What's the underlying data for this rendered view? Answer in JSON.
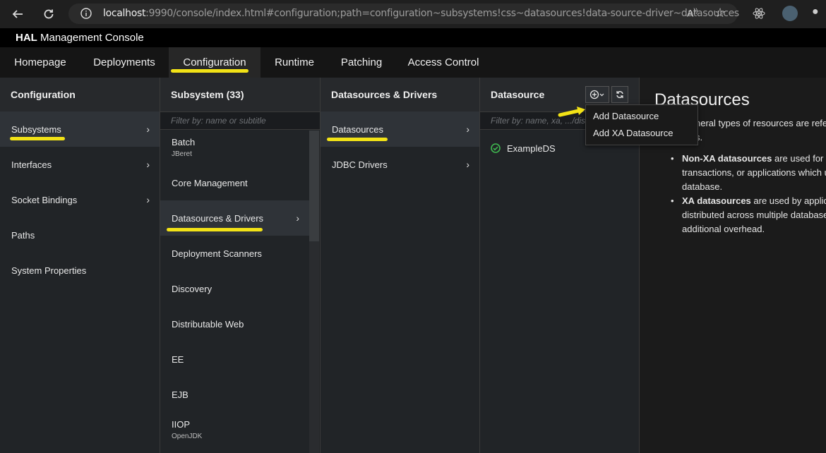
{
  "browser": {
    "url_host": "localhost",
    "url_rest": ":9990/console/index.html#configuration;path=configuration~subsystems!css~datasources!data-source-driver~datasources",
    "back_icon": "arrow-left-icon",
    "reload_icon": "reload-icon"
  },
  "app": {
    "title_bold": "HAL",
    "title_rest": "Management Console"
  },
  "nav": [
    "Homepage",
    "Deployments",
    "Configuration",
    "Runtime",
    "Patching",
    "Access Control"
  ],
  "col1": {
    "header": "Configuration",
    "items": [
      "Subsystems",
      "Interfaces",
      "Socket Bindings",
      "Paths",
      "System Properties"
    ]
  },
  "col2": {
    "header": "Subsystem (33)",
    "filter_placeholder": "Filter by: name or subtitle",
    "items": [
      {
        "label": "Batch",
        "sub": "JBeret"
      },
      {
        "label": "Core Management",
        "sub": ""
      },
      {
        "label": "Datasources & Drivers",
        "sub": ""
      },
      {
        "label": "Deployment Scanners",
        "sub": ""
      },
      {
        "label": "Discovery",
        "sub": ""
      },
      {
        "label": "Distributable Web",
        "sub": ""
      },
      {
        "label": "EE",
        "sub": ""
      },
      {
        "label": "EJB",
        "sub": ""
      },
      {
        "label": "IIOP",
        "sub": "OpenJDK"
      }
    ]
  },
  "col3": {
    "header": "Datasources & Drivers",
    "items": [
      "Datasources",
      "JDBC Drivers"
    ]
  },
  "col4": {
    "header": "Datasource",
    "filter_placeholder": "Filter by: name, xa, .../disa",
    "items": [
      "ExampleDS"
    ],
    "add_icon": "plus-circle-icon",
    "refresh_icon": "refresh-icon"
  },
  "menu": {
    "items": [
      "Add Datasource",
      "Add XA Datasource"
    ]
  },
  "content": {
    "title": "Datasources",
    "intro_line1": "neral types of resources are refe",
    "intro_line2": "s.",
    "b1_bold": "Non-XA datasources",
    "b1_l1": " are used for ap",
    "b1_l2": "transactions, or applications which u",
    "b1_l3": "database.",
    "b2_bold": "XA datasources",
    "b2_l1": " are used by applica",
    "b2_l2": "distributed across multiple database",
    "b2_l3": "additional overhead."
  },
  "colors": {
    "highlight": "#f2e216",
    "ok": "#3fb950"
  }
}
